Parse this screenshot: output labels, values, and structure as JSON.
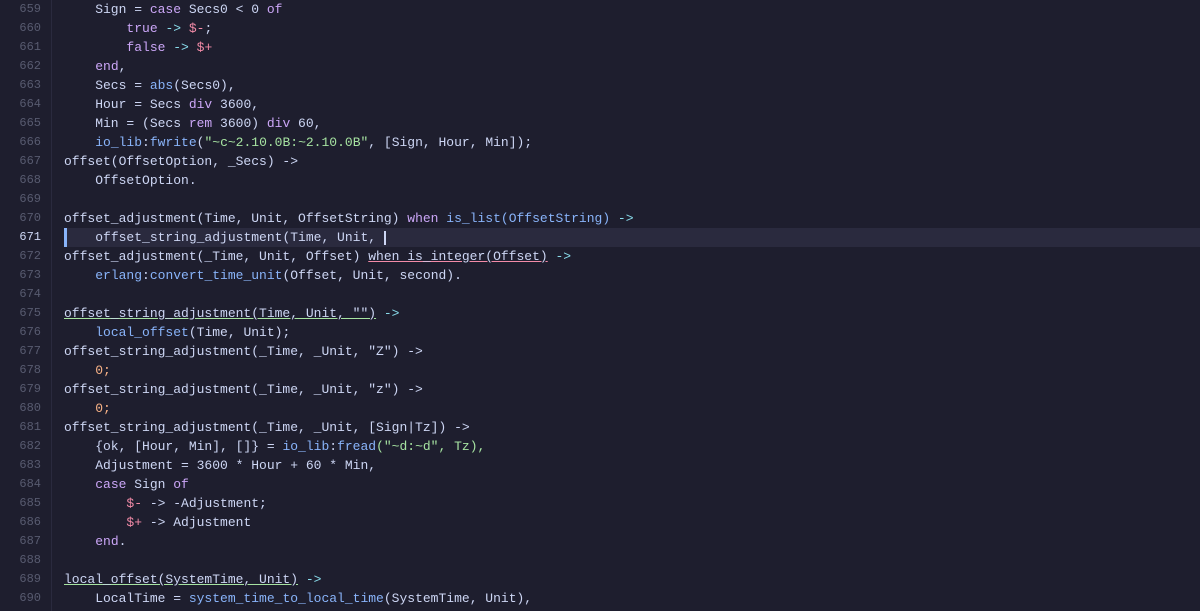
{
  "editor": {
    "background": "#1e1e2e",
    "lines": [
      {
        "num": 659,
        "active": false,
        "tokens": [
          {
            "t": "    Sign = ",
            "c": "var"
          },
          {
            "t": "case",
            "c": "kw"
          },
          {
            "t": " Secs0 < 0 ",
            "c": "var"
          },
          {
            "t": "of",
            "c": "kw"
          }
        ]
      },
      {
        "num": 660,
        "active": false,
        "tokens": [
          {
            "t": "        ",
            "c": ""
          },
          {
            "t": "true",
            "c": "kw"
          },
          {
            "t": " -> ",
            "c": "op"
          },
          {
            "t": "$-",
            "c": "dollar"
          },
          {
            "t": ";",
            "c": "punc"
          }
        ]
      },
      {
        "num": 661,
        "active": false,
        "tokens": [
          {
            "t": "        ",
            "c": ""
          },
          {
            "t": "false",
            "c": "kw"
          },
          {
            "t": " -> ",
            "c": "op"
          },
          {
            "t": "$+",
            "c": "dollar"
          }
        ]
      },
      {
        "num": 662,
        "active": false,
        "tokens": [
          {
            "t": "    ",
            "c": ""
          },
          {
            "t": "end",
            "c": "kw"
          },
          {
            "t": ",",
            "c": "punc"
          }
        ]
      },
      {
        "num": 663,
        "active": false,
        "tokens": [
          {
            "t": "    Secs = ",
            "c": "var"
          },
          {
            "t": "abs",
            "c": "fn"
          },
          {
            "t": "(Secs0),",
            "c": "punc"
          }
        ]
      },
      {
        "num": 664,
        "active": false,
        "tokens": [
          {
            "t": "    Hour = Secs ",
            "c": "var"
          },
          {
            "t": "div",
            "c": "kw"
          },
          {
            "t": " 3600,",
            "c": "punc"
          }
        ]
      },
      {
        "num": 665,
        "active": false,
        "tokens": [
          {
            "t": "    Min = (Secs ",
            "c": "var"
          },
          {
            "t": "rem",
            "c": "kw"
          },
          {
            "t": " 3600) ",
            "c": "var"
          },
          {
            "t": "div",
            "c": "kw"
          },
          {
            "t": " 60,",
            "c": "punc"
          }
        ]
      },
      {
        "num": 666,
        "active": false,
        "tokens": [
          {
            "t": "    ",
            "c": ""
          },
          {
            "t": "io_lib",
            "c": "builtin"
          },
          {
            "t": ":",
            "c": "punc"
          },
          {
            "t": "fwrite",
            "c": "fn"
          },
          {
            "t": "(\"~c~2.10.0B:~2.10.0B\", [Sign, Hour, Min]);",
            "c": "str"
          }
        ]
      },
      {
        "num": 667,
        "active": false,
        "tokens": [
          {
            "t": "offset(OffsetOption, _Secs) ->",
            "c": "var"
          }
        ]
      },
      {
        "num": 668,
        "active": false,
        "tokens": [
          {
            "t": "    OffsetOption.",
            "c": "var"
          }
        ]
      },
      {
        "num": 669,
        "active": false,
        "tokens": []
      },
      {
        "num": 670,
        "active": false,
        "tokens": [
          {
            "t": "offset_adjustment(Time, Unit, OffsetString) ",
            "c": "var"
          },
          {
            "t": "when",
            "c": "kw"
          },
          {
            "t": " ",
            "c": ""
          },
          {
            "t": "is_list(OffsetString)",
            "c": "fn"
          },
          {
            "t": " ->",
            "c": "op"
          }
        ]
      },
      {
        "num": 671,
        "active": true,
        "tokens": [
          {
            "t": "    offset_string_adjustment(Time, Unit, ",
            "c": "var"
          },
          {
            "t": "CURSOR",
            "c": "cursor"
          }
        ]
      },
      {
        "num": 672,
        "active": false,
        "tokens": [
          {
            "t": "offset_adjustment(_Time, Unit, Offset) ",
            "c": "var"
          },
          {
            "t": "when is_integer(Offset)",
            "c": "underline"
          },
          {
            "t": " ->",
            "c": "op"
          }
        ]
      },
      {
        "num": 673,
        "active": false,
        "tokens": [
          {
            "t": "    ",
            "c": ""
          },
          {
            "t": "erlang",
            "c": "builtin"
          },
          {
            "t": ":",
            "c": "punc"
          },
          {
            "t": "convert_time_unit",
            "c": "fn"
          },
          {
            "t": "(Offset, Unit, second).",
            "c": "var"
          }
        ]
      },
      {
        "num": 674,
        "active": false,
        "tokens": []
      },
      {
        "num": 675,
        "active": false,
        "tokens": [
          {
            "t": "offset_string_adjustment(Time, Unit, \"\")",
            "c": "underline-fn"
          },
          {
            "t": " ->",
            "c": "op"
          }
        ]
      },
      {
        "num": 676,
        "active": false,
        "tokens": [
          {
            "t": "    ",
            "c": ""
          },
          {
            "t": "local_offset",
            "c": "fn"
          },
          {
            "t": "(Time, Unit);",
            "c": "var"
          }
        ]
      },
      {
        "num": 677,
        "active": false,
        "tokens": [
          {
            "t": "offset_string_adjustment(_Time, _Unit, \"Z\") ->",
            "c": "var"
          }
        ]
      },
      {
        "num": 678,
        "active": false,
        "tokens": [
          {
            "t": "    0;",
            "c": "num"
          }
        ]
      },
      {
        "num": 679,
        "active": false,
        "tokens": [
          {
            "t": "offset_string_adjustment(_Time, _Unit, \"z\") ->",
            "c": "var"
          }
        ]
      },
      {
        "num": 680,
        "active": false,
        "tokens": [
          {
            "t": "    0;",
            "c": "num"
          }
        ]
      },
      {
        "num": 681,
        "active": false,
        "tokens": [
          {
            "t": "offset_string_adjustment(_Time, _Unit, [Sign|Tz]) ->",
            "c": "var"
          }
        ]
      },
      {
        "num": 682,
        "active": false,
        "tokens": [
          {
            "t": "    {ok, [Hour, Min], []} = ",
            "c": "var"
          },
          {
            "t": "io_lib",
            "c": "builtin"
          },
          {
            "t": ":",
            "c": "punc"
          },
          {
            "t": "fread",
            "c": "fn"
          },
          {
            "t": "(\"~d:~d\", Tz),",
            "c": "str"
          }
        ]
      },
      {
        "num": 683,
        "active": false,
        "tokens": [
          {
            "t": "    Adjustment = 3600 * Hour + 60 * Min,",
            "c": "var"
          }
        ]
      },
      {
        "num": 684,
        "active": false,
        "tokens": [
          {
            "t": "    ",
            "c": ""
          },
          {
            "t": "case",
            "c": "kw"
          },
          {
            "t": " Sign ",
            "c": "var"
          },
          {
            "t": "of",
            "c": "kw"
          }
        ]
      },
      {
        "num": 685,
        "active": false,
        "tokens": [
          {
            "t": "        ",
            "c": ""
          },
          {
            "t": "$-",
            "c": "dollar"
          },
          {
            "t": " -> -Adjustment;",
            "c": "var"
          }
        ]
      },
      {
        "num": 686,
        "active": false,
        "tokens": [
          {
            "t": "        ",
            "c": ""
          },
          {
            "t": "$+",
            "c": "dollar"
          },
          {
            "t": " -> Adjustment",
            "c": "var"
          }
        ]
      },
      {
        "num": 687,
        "active": false,
        "tokens": [
          {
            "t": "    ",
            "c": ""
          },
          {
            "t": "end",
            "c": "kw"
          },
          {
            "t": ".",
            "c": "punc"
          }
        ]
      },
      {
        "num": 688,
        "active": false,
        "tokens": []
      },
      {
        "num": 689,
        "active": false,
        "tokens": [
          {
            "t": "local_offset(SystemTime, Unit)",
            "c": "underline-fn2"
          },
          {
            "t": " ->",
            "c": "op"
          }
        ]
      },
      {
        "num": 690,
        "active": false,
        "tokens": [
          {
            "t": "    LocalTime = ",
            "c": "var"
          },
          {
            "t": "system_time_to_local_time",
            "c": "fn"
          },
          {
            "t": "(SystemTime, Unit),",
            "c": "var"
          }
        ]
      }
    ]
  }
}
